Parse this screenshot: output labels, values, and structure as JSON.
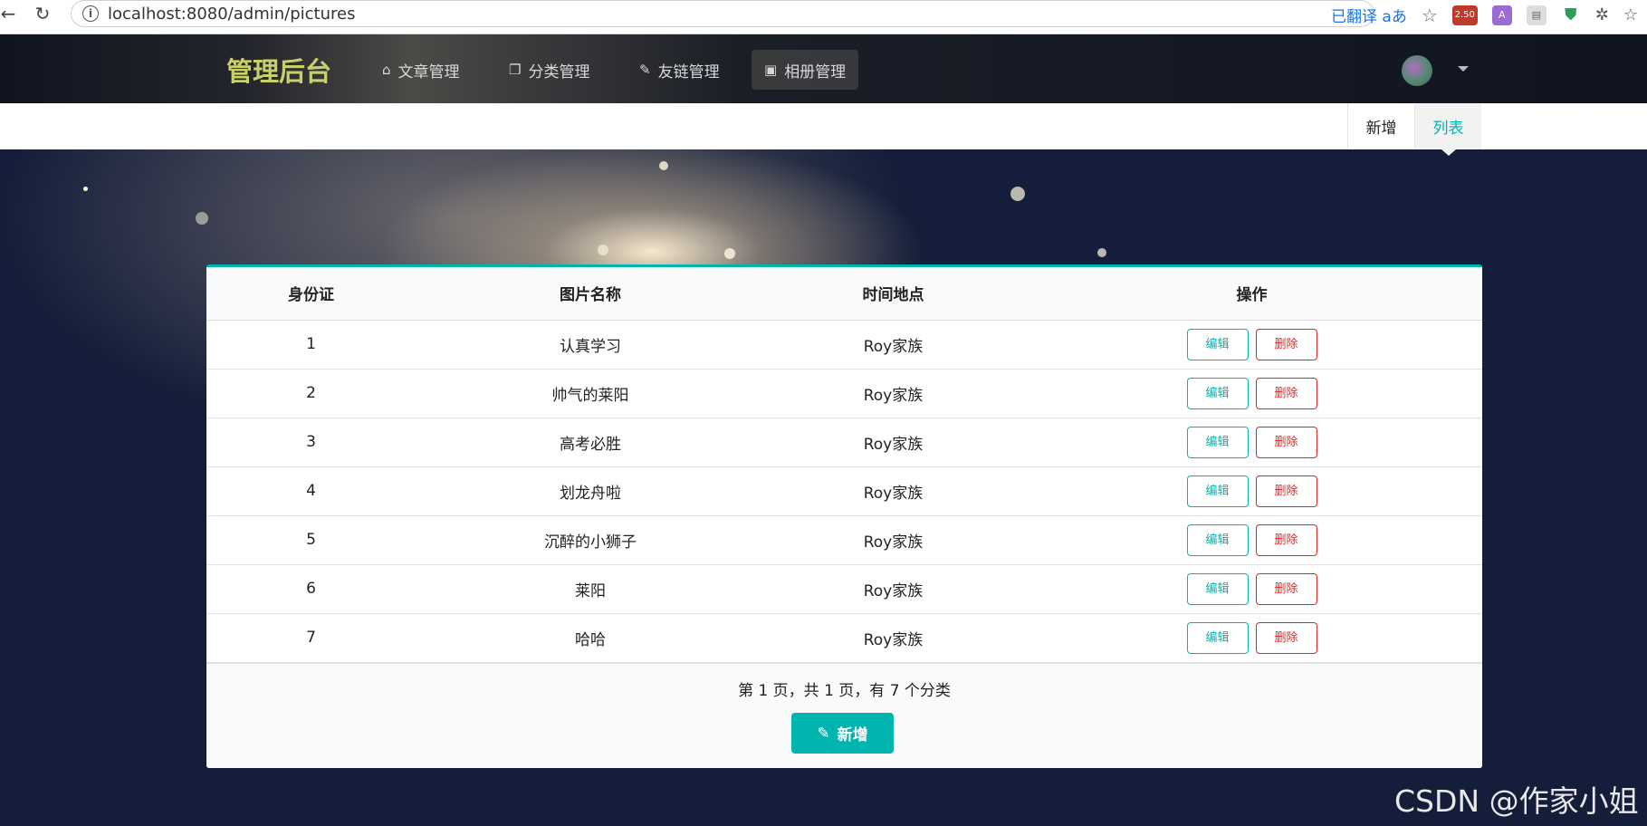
{
  "browser": {
    "url": "localhost:8080/admin/pictures",
    "translate_label": "已翻译",
    "badge_count": "2.50"
  },
  "header": {
    "logo": "管理后台",
    "menu": [
      {
        "label": "文章管理",
        "icon": "home-icon"
      },
      {
        "label": "分类管理",
        "icon": "copy-icon"
      },
      {
        "label": "友链管理",
        "icon": "pencil-icon"
      },
      {
        "label": "相册管理",
        "icon": "image-icon"
      }
    ]
  },
  "subnav": {
    "items": [
      {
        "label": "新增"
      },
      {
        "label": "列表"
      }
    ]
  },
  "table": {
    "columns": [
      "身份证",
      "图片名称",
      "时间地点",
      "操作"
    ],
    "rows": [
      {
        "id": "1",
        "name": "认真学习",
        "place": "Roy家族"
      },
      {
        "id": "2",
        "name": "帅气的莱阳",
        "place": "Roy家族"
      },
      {
        "id": "3",
        "name": "高考必胜",
        "place": "Roy家族"
      },
      {
        "id": "4",
        "name": "划龙舟啦",
        "place": "Roy家族"
      },
      {
        "id": "5",
        "name": "沉醉的小狮子",
        "place": "Roy家族"
      },
      {
        "id": "6",
        "name": "莱阳",
        "place": "Roy家族"
      },
      {
        "id": "7",
        "name": "哈哈",
        "place": "Roy家族"
      }
    ],
    "edit_label": "编辑",
    "delete_label": "删除",
    "page_info": "第 1 页，共 1 页，有 7 个分类",
    "add_label": "新增"
  },
  "watermark": "CSDN @作家小姐",
  "colors": {
    "accent": "#00b5ad",
    "danger": "#db2828",
    "logo": "#c9d06a"
  }
}
